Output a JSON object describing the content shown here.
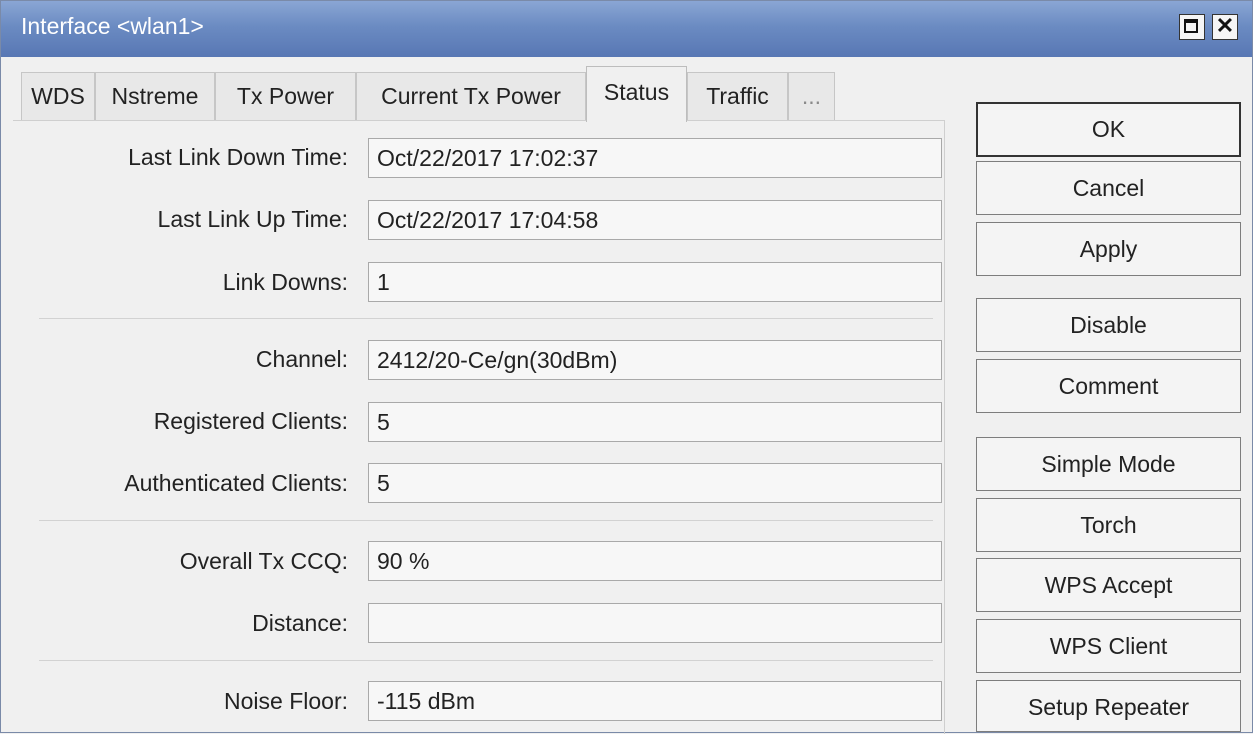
{
  "window": {
    "title": "Interface <wlan1>",
    "close_glyph": "✕"
  },
  "tabs": [
    {
      "label": "WDS"
    },
    {
      "label": "Nstreme"
    },
    {
      "label": "Tx Power"
    },
    {
      "label": "Current Tx Power"
    },
    {
      "label": "Status",
      "active": true
    },
    {
      "label": "Traffic"
    },
    {
      "label": "..."
    }
  ],
  "status": {
    "last_link_down_time": {
      "label": "Last Link Down Time:",
      "value": "Oct/22/2017 17:02:37"
    },
    "last_link_up_time": {
      "label": "Last Link Up Time:",
      "value": "Oct/22/2017 17:04:58"
    },
    "link_downs": {
      "label": "Link Downs:",
      "value": "1"
    },
    "channel": {
      "label": "Channel:",
      "value": "2412/20-Ce/gn(30dBm)"
    },
    "registered_clients": {
      "label": "Registered Clients:",
      "value": "5"
    },
    "authenticated_clients": {
      "label": "Authenticated Clients:",
      "value": "5"
    },
    "overall_tx_ccq": {
      "label": "Overall Tx CCQ:",
      "value": "90 %"
    },
    "distance": {
      "label": "Distance:",
      "value": ""
    },
    "noise_floor": {
      "label": "Noise Floor:",
      "value": "-115 dBm"
    }
  },
  "buttons": {
    "ok": "OK",
    "cancel": "Cancel",
    "apply": "Apply",
    "disable": "Disable",
    "comment": "Comment",
    "simple_mode": "Simple Mode",
    "torch": "Torch",
    "wps_accept": "WPS Accept",
    "wps_client": "WPS Client",
    "setup_repeater": "Setup Repeater"
  },
  "colors": {
    "titlebar": "#6b8bc2",
    "window_bg": "#f0f0f0",
    "field_bg": "#f7f7f7"
  }
}
